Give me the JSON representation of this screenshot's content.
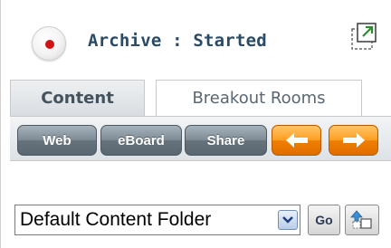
{
  "header": {
    "status_text": "Archive : Started",
    "record_icon": "record-dot-icon",
    "popout_icon": "popout-window-icon"
  },
  "tabs": [
    {
      "label": "Content",
      "active": true
    },
    {
      "label": "Breakout Rooms",
      "active": false
    }
  ],
  "toolbar": {
    "buttons": [
      {
        "label": "Web"
      },
      {
        "label": "eBoard"
      },
      {
        "label": "Share"
      }
    ],
    "back_icon": "arrow-left-icon",
    "forward_icon": "arrow-right-icon"
  },
  "folder": {
    "selected": "Default Content Folder",
    "go_label": "Go",
    "upload_icon": "upload-folder-icon"
  },
  "colors": {
    "record": "#d11212",
    "status_text": "#2a4a66",
    "arrow_orange": "#ff9d1e",
    "button_gray": "#7d8a94"
  }
}
